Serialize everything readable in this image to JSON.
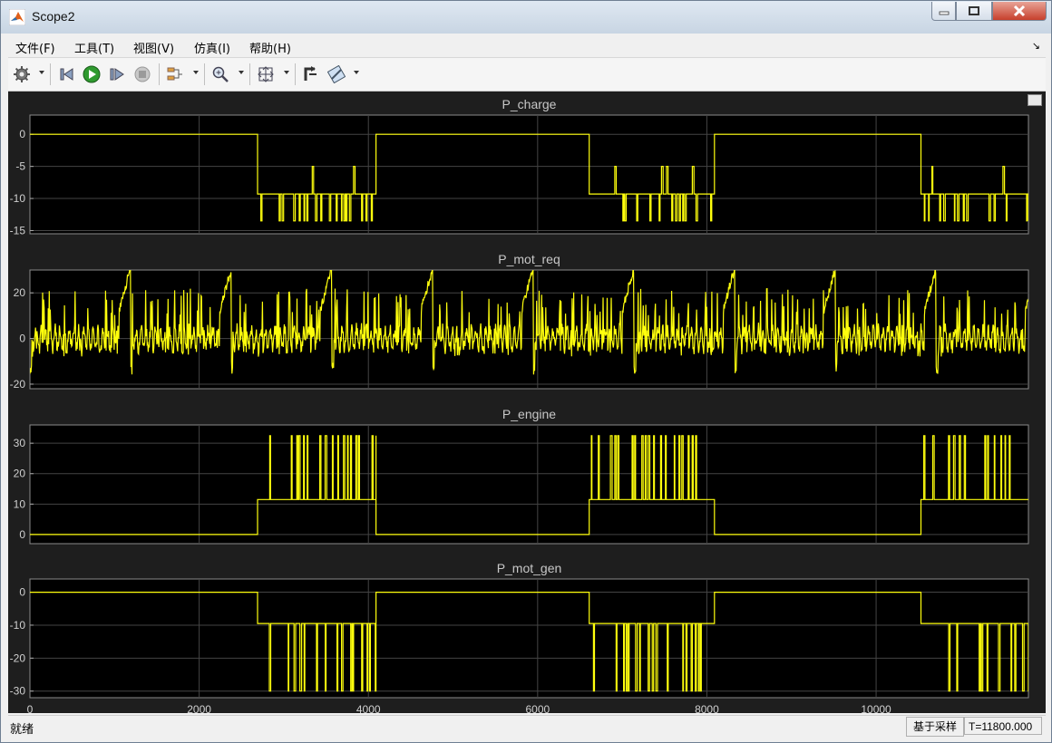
{
  "window": {
    "title": "Scope2"
  },
  "menu": {
    "items": [
      "文件(F)",
      "工具(T)",
      "视图(V)",
      "仿真(I)",
      "帮助(H)"
    ]
  },
  "toolbar": {
    "icons": [
      "gear-icon",
      "step-back-icon",
      "run-icon",
      "step-forward-icon",
      "stop-icon",
      "signal-select-icon",
      "zoom-icon",
      "fit-to-view-icon",
      "cursor-measure-icon",
      "highlight-icon"
    ]
  },
  "status": {
    "text": "就绪",
    "mode": "基于采样",
    "time": "T=11800.000"
  },
  "colors": {
    "plot_bg": "#000000",
    "figure_bg": "#1e1e1e",
    "line": "#ffff0d",
    "grid": "#444444"
  },
  "chart_data": [
    {
      "type": "line",
      "title": "P_charge",
      "xlim": [
        0,
        11800
      ],
      "ylim": [
        -15.5,
        3
      ],
      "yticks": [
        0,
        -5,
        -10,
        -15
      ],
      "grid": true,
      "pattern": "switching",
      "baseline": 0,
      "levels": [
        -9.3,
        -13.5,
        -5,
        0
      ],
      "active_intervals": [
        [
          2690,
          4090
        ],
        [
          6610,
          8090
        ],
        [
          10530,
          11800
        ]
      ]
    },
    {
      "type": "line",
      "title": "P_mot_req",
      "xlim": [
        0,
        11800
      ],
      "ylim": [
        -22,
        30
      ],
      "yticks": [
        20,
        0,
        -20
      ],
      "grid": true,
      "pattern": "drive-cycle",
      "cycle_period": 1190,
      "range": [
        -17,
        31
      ]
    },
    {
      "type": "line",
      "title": "P_engine",
      "xlim": [
        0,
        11800
      ],
      "ylim": [
        -3,
        36
      ],
      "yticks": [
        30,
        20,
        10,
        0
      ],
      "grid": true,
      "pattern": "switching",
      "baseline": 0,
      "levels": [
        11.5,
        32.5
      ],
      "active_intervals": [
        [
          2690,
          4090
        ],
        [
          6610,
          8090
        ],
        [
          10530,
          11800
        ]
      ]
    },
    {
      "type": "line",
      "title": "P_mot_gen",
      "xlim": [
        0,
        11800
      ],
      "ylim": [
        -32,
        4
      ],
      "yticks": [
        0,
        -10,
        -20,
        -30
      ],
      "xticks": [
        0,
        2000,
        4000,
        6000,
        8000,
        10000
      ],
      "grid": true,
      "pattern": "switching",
      "baseline": 0,
      "levels": [
        -9.5,
        -30
      ],
      "active_intervals": [
        [
          2690,
          4090
        ],
        [
          6610,
          8090
        ],
        [
          10530,
          11800
        ]
      ]
    }
  ]
}
